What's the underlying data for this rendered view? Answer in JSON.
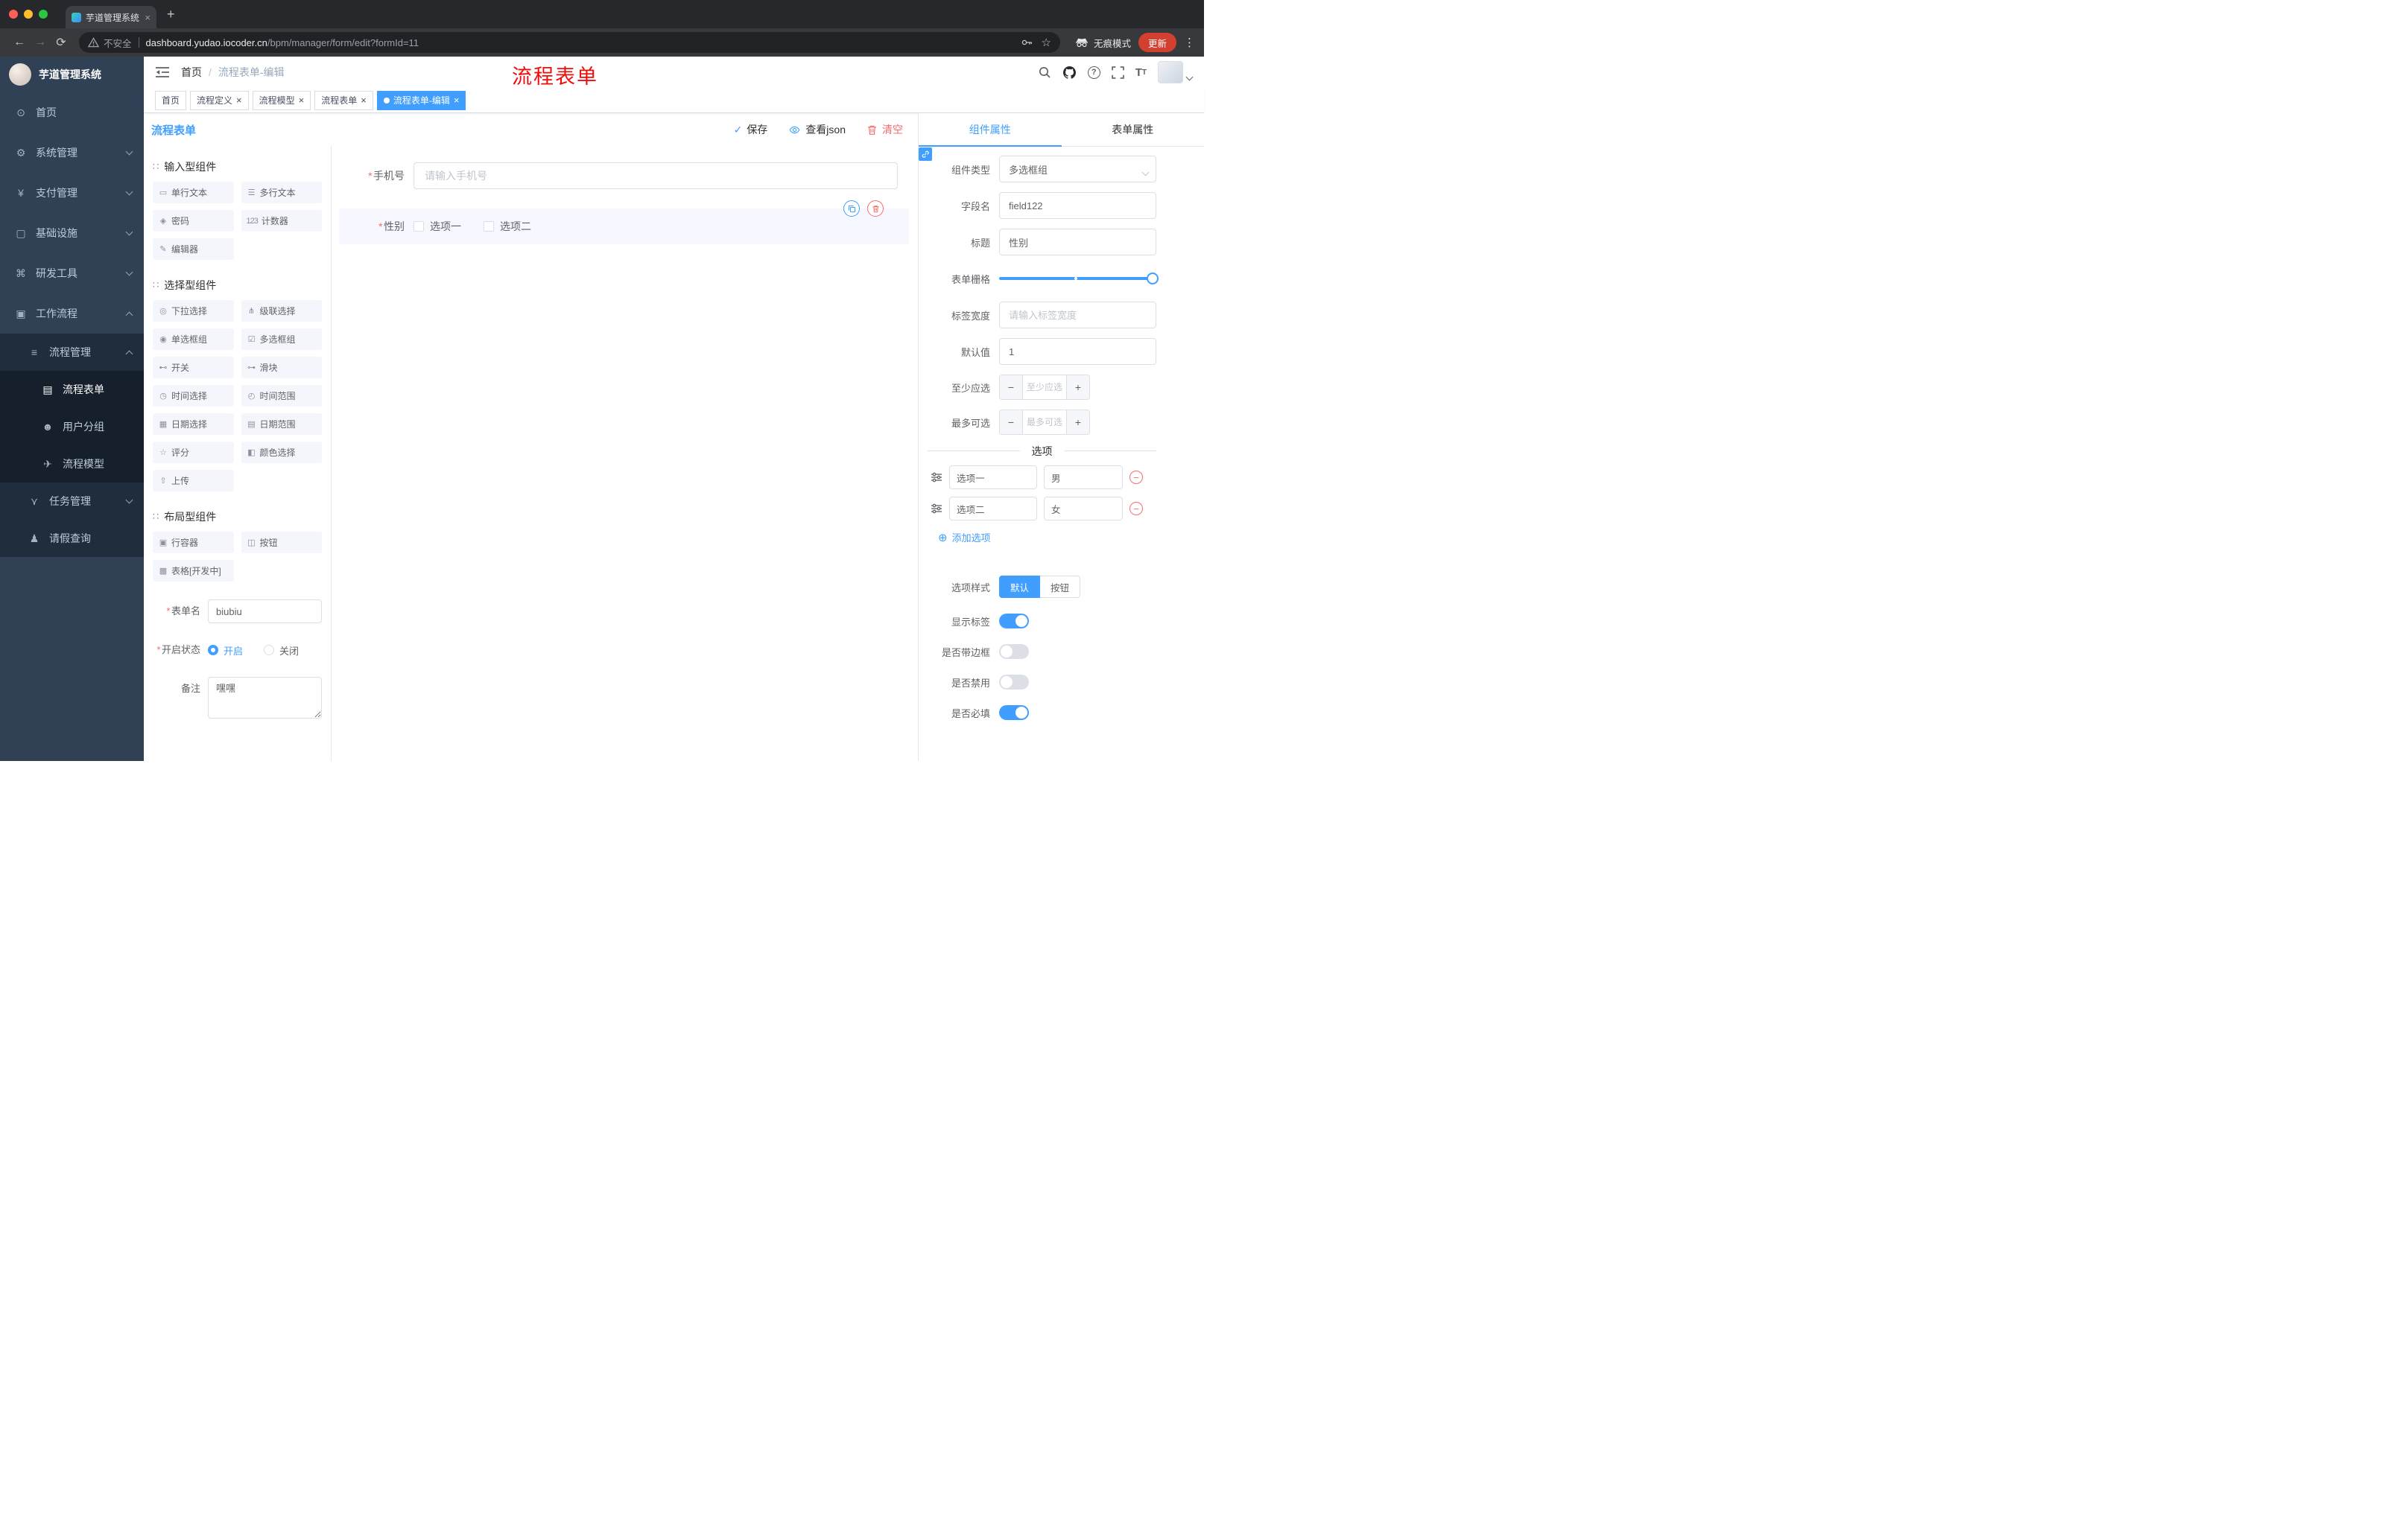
{
  "colors": {
    "primary": "#409eff",
    "danger": "#f56c6c",
    "sidebar_bg": "#304156",
    "annotation_red": "#f10c0c"
  },
  "browser": {
    "tab_title": "芋道管理系统",
    "security_label": "不安全",
    "url_host": "dashboard.yudao.iocoder.cn",
    "url_path": "/bpm/manager/form/edit?formId=11",
    "incognito_label": "无痕模式",
    "update_label": "更新"
  },
  "sidebar": {
    "app_title": "芋道管理系统",
    "items": [
      {
        "icon": "⊙",
        "label": "首页"
      },
      {
        "icon": "⚙",
        "label": "系统管理"
      },
      {
        "icon": "¥",
        "label": "支付管理"
      },
      {
        "icon": "▢",
        "label": "基础设施"
      },
      {
        "icon": "⌘",
        "label": "研发工具"
      },
      {
        "icon": "▣",
        "label": "工作流程"
      },
      {
        "icon": "≡",
        "label": "流程管理"
      },
      {
        "icon": "▤",
        "label": "流程表单"
      },
      {
        "icon": "☻",
        "label": "用户分组"
      },
      {
        "icon": "✈",
        "label": "流程模型"
      },
      {
        "icon": "⋎",
        "label": "任务管理"
      },
      {
        "icon": "♟",
        "label": "请假查询"
      }
    ]
  },
  "header": {
    "breadcrumb_home": "首页",
    "breadcrumb_sep": "/",
    "breadcrumb_current": "流程表单-编辑",
    "annotation": "流程表单"
  },
  "tags": [
    {
      "label": "首页"
    },
    {
      "label": "流程定义"
    },
    {
      "label": "流程模型"
    },
    {
      "label": "流程表单"
    },
    {
      "label": "流程表单-编辑"
    }
  ],
  "designer": {
    "title": "流程表单",
    "toolbar": {
      "save": "保存",
      "view_json": "查看json",
      "clear": "清空"
    },
    "palette": {
      "groups": [
        {
          "title": "输入型组件",
          "items": [
            {
              "icon": "▭",
              "label": "单行文本"
            },
            {
              "icon": "☰",
              "label": "多行文本"
            },
            {
              "icon": "◈",
              "label": "密码"
            },
            {
              "icon": "123",
              "label": "计数器"
            },
            {
              "icon": "✎",
              "label": "编辑器"
            }
          ]
        },
        {
          "title": "选择型组件",
          "items": [
            {
              "icon": "◎",
              "label": "下拉选择"
            },
            {
              "icon": "⋔",
              "label": "级联选择"
            },
            {
              "icon": "◉",
              "label": "单选框组"
            },
            {
              "icon": "☑",
              "label": "多选框组"
            },
            {
              "icon": "⊷",
              "label": "开关"
            },
            {
              "icon": "⊶",
              "label": "滑块"
            },
            {
              "icon": "◷",
              "label": "时间选择"
            },
            {
              "icon": "◴",
              "label": "时间范围"
            },
            {
              "icon": "▦",
              "label": "日期选择"
            },
            {
              "icon": "▤",
              "label": "日期范围"
            },
            {
              "icon": "☆",
              "label": "评分"
            },
            {
              "icon": "◧",
              "label": "颜色选择"
            },
            {
              "icon": "⇧",
              "label": "上传"
            }
          ]
        },
        {
          "title": "布局型组件",
          "items": [
            {
              "icon": "▣",
              "label": "行容器"
            },
            {
              "icon": "◫",
              "label": "按钮"
            },
            {
              "icon": "▩",
              "label": "表格[开发中]"
            }
          ]
        }
      ]
    },
    "meta": {
      "name_label": "表单名",
      "name_value": "biubiu",
      "status_label": "开启状态",
      "status_on": "开启",
      "status_off": "关闭",
      "remark_label": "备注",
      "remark_value": "嘿嘿"
    },
    "canvas": {
      "phone_label": "手机号",
      "phone_placeholder": "请输入手机号",
      "gender_label": "性别",
      "gender_option1": "选项一",
      "gender_option2": "选项二"
    },
    "props": {
      "tab_component": "组件属性",
      "tab_form": "表单属性",
      "type_label": "组件类型",
      "type_value": "多选框组",
      "field_label": "字段名",
      "field_value": "field122",
      "title_label": "标题",
      "title_value": "性别",
      "grid_label": "表单栅格",
      "width_label": "标签宽度",
      "width_placeholder": "请输入标签宽度",
      "default_label": "默认值",
      "default_value": "1",
      "min_label": "至少应选",
      "min_placeholder": "至少应选",
      "max_label": "最多可选",
      "max_placeholder": "最多可选",
      "options_divider": "选项",
      "option1_name": "选项一",
      "option1_value": "男",
      "option2_name": "选项二",
      "option2_value": "女",
      "add_option": "添加选项",
      "style_label": "选项样式",
      "style_default": "默认",
      "style_button": "按钮",
      "switch1_label": "显示标签",
      "switch2_label": "是否带边框",
      "switch3_label": "是否禁用",
      "switch4_label": "是否必填"
    }
  }
}
